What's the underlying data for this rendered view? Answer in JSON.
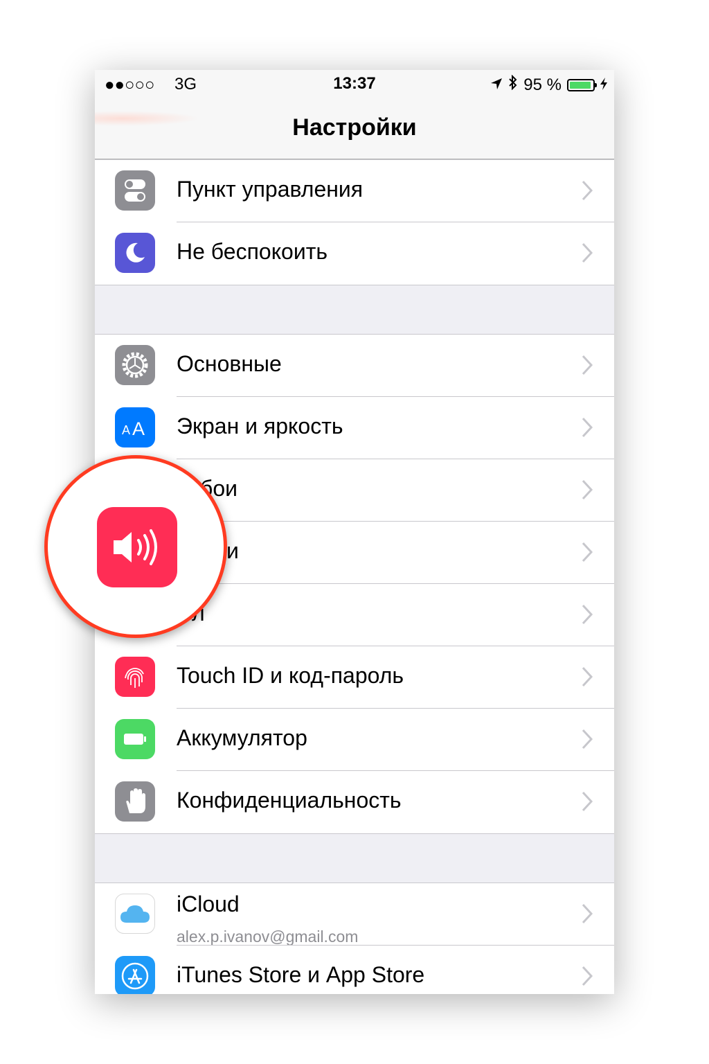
{
  "status_bar": {
    "signal": "●●○○○",
    "network": "3G",
    "time": "13:37",
    "battery_text": "95 %",
    "battery_level": 0.95
  },
  "nav": {
    "title": "Настройки"
  },
  "sections": [
    {
      "items": [
        {
          "label": "Пункт управления",
          "icon": "control-center-icon",
          "color": "#8e8e93"
        },
        {
          "label": "Не беспокоить",
          "icon": "moon-icon",
          "color": "#5856d6"
        }
      ]
    },
    {
      "items": [
        {
          "label": "Основные",
          "icon": "gear-icon",
          "color": "#8e8e93"
        },
        {
          "label": "Экран и яркость",
          "icon": "text-size-icon",
          "color": "#007aff"
        },
        {
          "label": "бои",
          "icon": "wallpaper-icon",
          "color": "#34aadc"
        },
        {
          "label": "и",
          "icon": "sounds-icon",
          "color": "#ff2d55"
        },
        {
          "label": "л",
          "icon": "siri-icon",
          "color": "#1c1c3c"
        },
        {
          "label": "Touch ID и код-пароль",
          "icon": "fingerprint-icon",
          "color": "#ff2d55"
        },
        {
          "label": "Аккумулятор",
          "icon": "battery-icon",
          "color": "#4cd964"
        },
        {
          "label": "Конфиденциальность",
          "icon": "hand-icon",
          "color": "#8e8e93"
        }
      ]
    },
    {
      "items": [
        {
          "label": "iCloud",
          "sub": "alex.p.ivanov@gmail.com",
          "icon": "cloud-icon",
          "color": "#ffffff"
        },
        {
          "label": "iTunes Store и App Store",
          "icon": "app-store-icon",
          "color": "#1e9af8"
        }
      ]
    }
  ],
  "magnifier": {
    "icon": "speaker-icon",
    "color": "#ff2d55"
  }
}
